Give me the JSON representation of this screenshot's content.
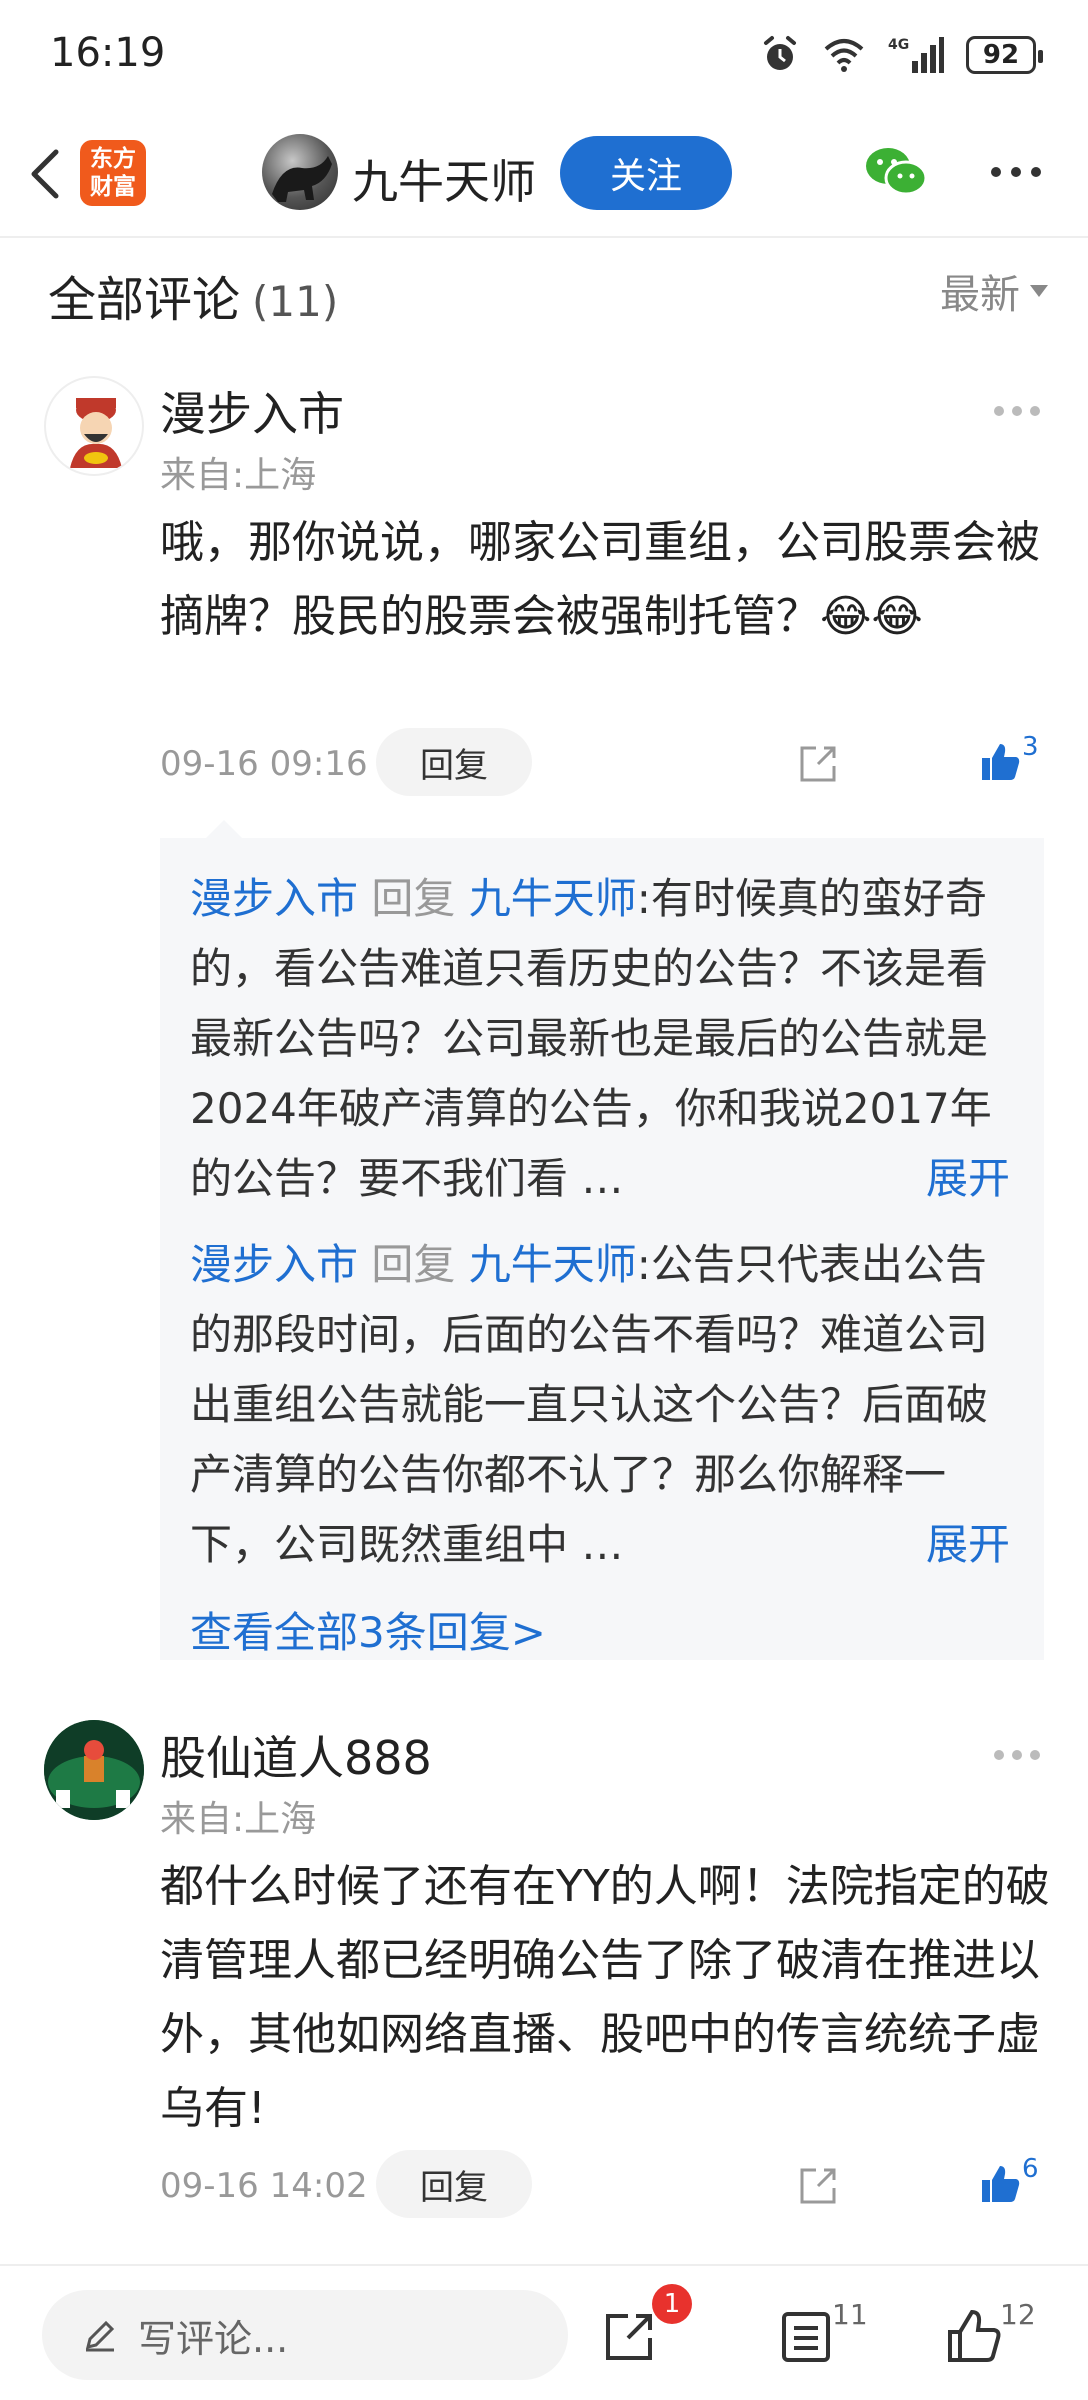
{
  "status_bar": {
    "time": "16:19",
    "battery": "92",
    "network": "4G"
  },
  "nav": {
    "logo_line1": "东方",
    "logo_line2": "财富",
    "author": "九牛天师",
    "follow_label": "关注"
  },
  "section": {
    "title": "全部评论",
    "count": "(11)",
    "sort_label": "最新"
  },
  "comments": [
    {
      "name": "漫步入市",
      "location": "来自:上海",
      "text": "哦，那你说说，哪家公司重组，公司股票会被摘牌？股民的股票会被强制托管？😂😂",
      "time": "09-16 09:16",
      "reply_label": "回复",
      "likes": "3"
    },
    {
      "name": "股仙道人888",
      "location": "来自:上海",
      "text": "都什么时候了还有在YY的人啊！法院指定的破清管理人都已经明确公告了除了破清在推进以外，其他如网络直播、股吧中的传言统统子虚乌有!",
      "time": "09-16 14:02",
      "reply_label": "回复",
      "likes": "6"
    }
  ],
  "replies": [
    {
      "from": "漫步入市",
      "verb": "回复",
      "to": "九牛天师",
      "text": ":有时候真的蛮好奇的，看公告难道只看历史的公告？不该是看最新公告吗？公司最新也是最后的公告就是2024年破产清算的公告，你和我说2017年的公告？要不我们看 …",
      "expand": "展开"
    },
    {
      "from": "漫步入市",
      "verb": "回复",
      "to": "九牛天师",
      "text": ":公告只代表出公告的那段时间，后面的公告不看吗？难道公司出重组公告就能一直只认这个公告？后面破产清算的公告你都不认了？那么你解释一下，公司既然重组中 …",
      "expand": "展开"
    }
  ],
  "view_all_replies": "查看全部3条回复>",
  "bottom_bar": {
    "write_placeholder": "写评论...",
    "share_badge": "1",
    "comments_count": "11",
    "likes_count": "12"
  },
  "colors": {
    "accent": "#1f6fd1",
    "badge": "#e8322d",
    "logo": "#f05a1c",
    "wechat": "#3cb034"
  }
}
